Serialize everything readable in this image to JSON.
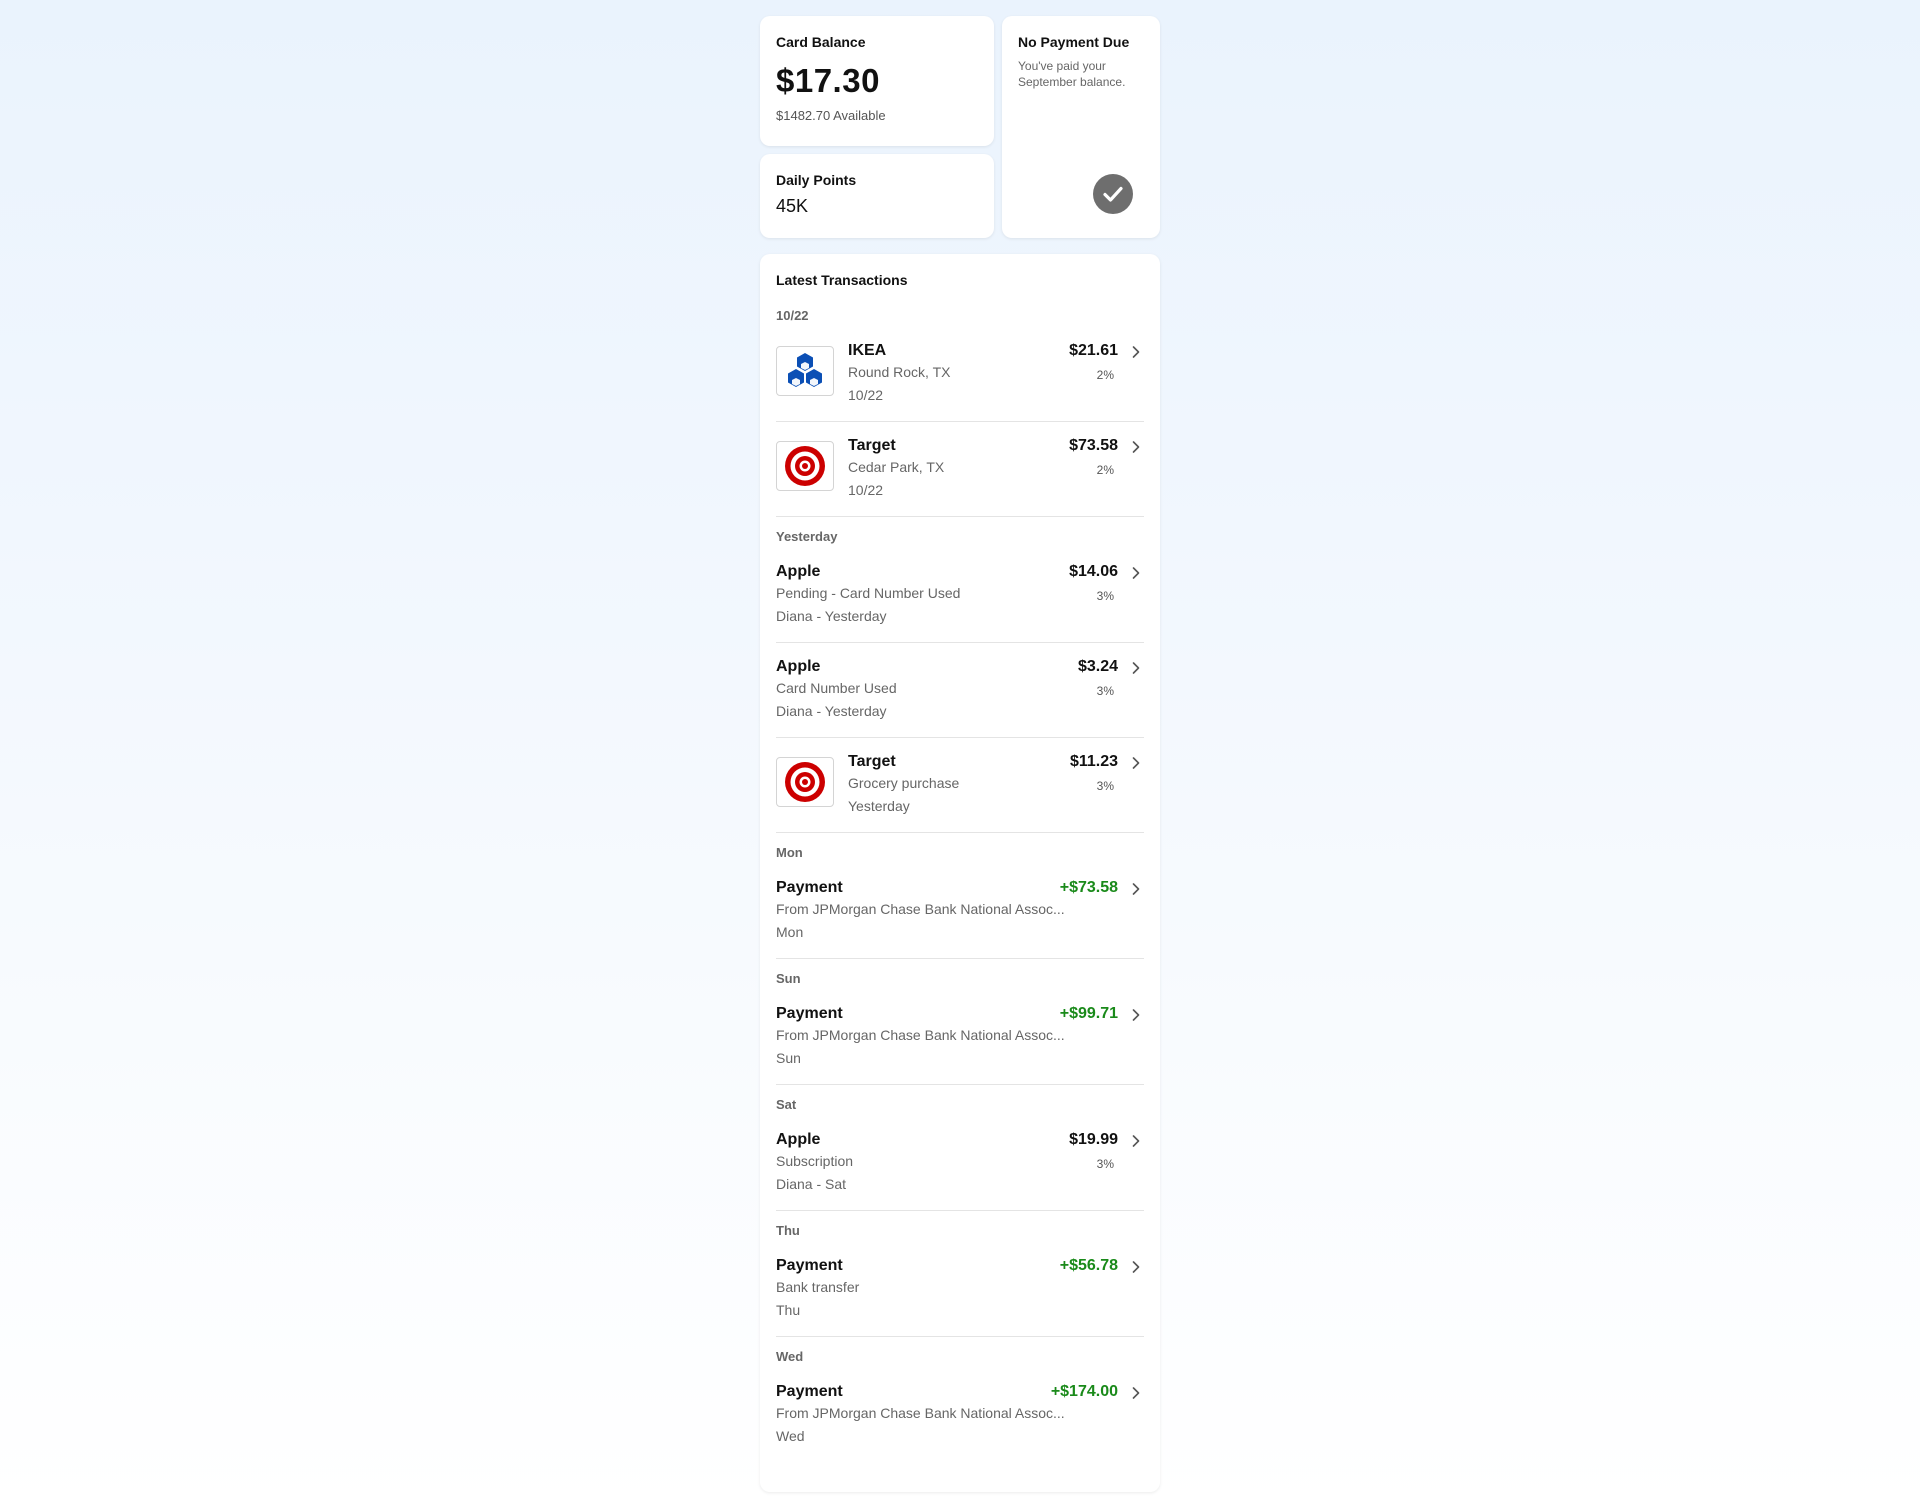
{
  "balance": {
    "title": "Card Balance",
    "amount": "$17.30",
    "available": "$1482.70 Available"
  },
  "points": {
    "title": "Daily Points",
    "value": "45K"
  },
  "payment": {
    "title": "No Payment Due",
    "subtitle": "You've paid your September balance.",
    "icon": "check-icon"
  },
  "transactions": {
    "header": "Latest Transactions",
    "groups": [
      {
        "label": "10/22",
        "items": [
          {
            "merchant": "IKEA",
            "line1": "Round Rock, TX",
            "line2": "10/22",
            "amount": "$21.61",
            "percent": "2%",
            "logo": "ikea-logo"
          },
          {
            "merchant": "Target",
            "line1": "Cedar Park, TX",
            "line2": "10/22",
            "amount": "$73.58",
            "percent": "2%",
            "logo": "target-logo"
          }
        ]
      },
      {
        "label": "Yesterday",
        "items": [
          {
            "merchant": "Apple",
            "line1": "Pending - Card Number Used",
            "line2": "Diana - Yesterday",
            "amount": "$14.06",
            "percent": "3%"
          },
          {
            "merchant": "Apple",
            "line1": "Card Number Used",
            "line2": "Diana - Yesterday",
            "amount": "$3.24",
            "percent": "3%"
          },
          {
            "merchant": "Target",
            "line1": "Grocery purchase",
            "line2": "Yesterday",
            "amount": "$11.23",
            "percent": "3%",
            "logo": "target-logo"
          }
        ]
      },
      {
        "label": "Mon",
        "items": [
          {
            "merchant": "Payment",
            "line1": "From JPMorgan Chase Bank National Assoc...",
            "line2": "Mon",
            "amount": "+$73.58",
            "credit": true
          }
        ]
      },
      {
        "label": "Sun",
        "items": [
          {
            "merchant": "Payment",
            "line1": "From JPMorgan Chase Bank National Assoc...",
            "line2": "Sun",
            "amount": "+$99.71",
            "credit": true
          }
        ]
      },
      {
        "label": "Sat",
        "items": [
          {
            "merchant": "Apple",
            "line1": "Subscription",
            "line2": "Diana - Sat",
            "amount": "$19.99",
            "percent": "3%"
          }
        ]
      },
      {
        "label": "Thu",
        "items": [
          {
            "merchant": "Payment",
            "line1": "Bank transfer",
            "line2": "Thu",
            "amount": "+$56.78",
            "credit": true
          }
        ]
      },
      {
        "label": "Wed",
        "items": [
          {
            "merchant": "Payment",
            "line1": "From JPMorgan Chase Bank National Assoc...",
            "line2": "Wed",
            "amount": "+$174.00",
            "credit": true
          }
        ]
      }
    ]
  },
  "colors": {
    "credit": "#1a8a1a",
    "ikea_blue": "#0b4fb5",
    "target_red": "#cc0000",
    "check_gray": "#6e6e6e"
  }
}
